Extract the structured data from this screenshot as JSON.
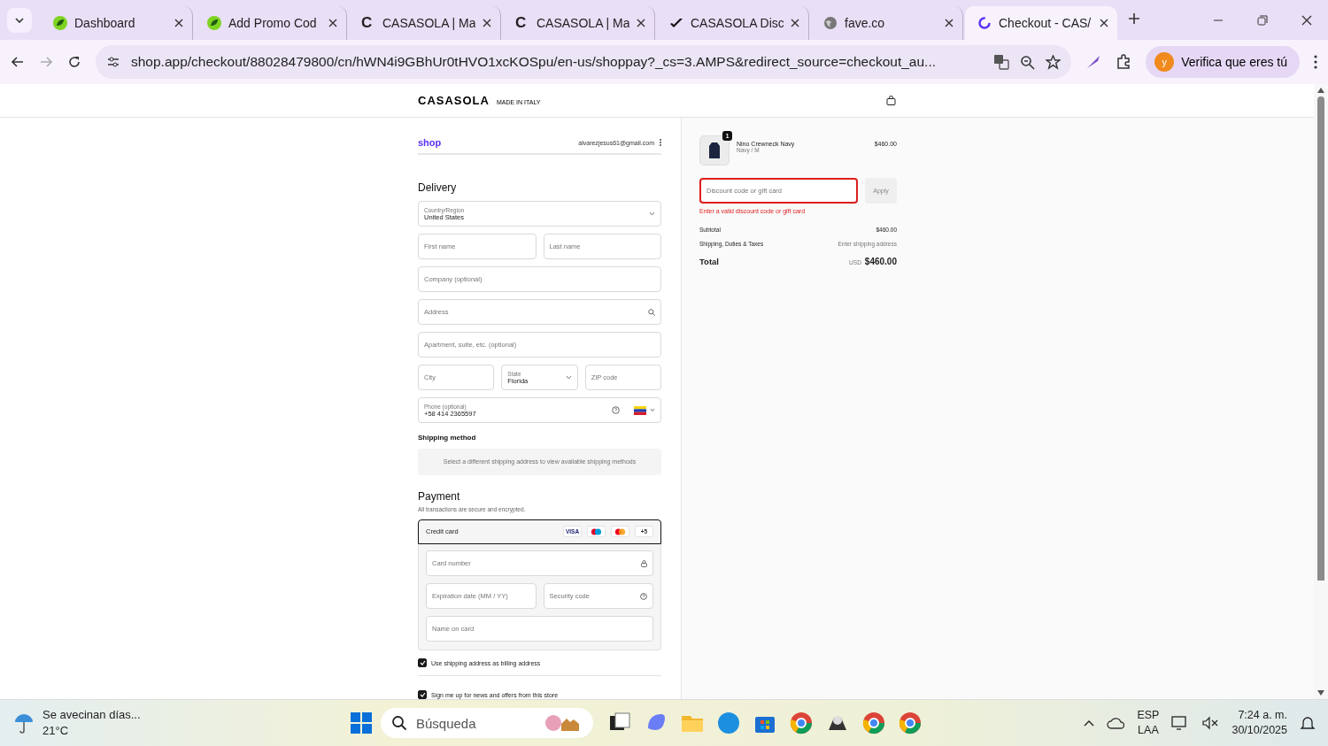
{
  "browser": {
    "tabs": [
      {
        "title": "Dashboard",
        "kind": "leaf",
        "selected": false
      },
      {
        "title": "Add Promo Cod",
        "kind": "leaf",
        "selected": false
      },
      {
        "title": "CASASOLA | Ma",
        "kind": "letter",
        "glyph": "C",
        "selected": false
      },
      {
        "title": "CASASOLA | Ma",
        "kind": "letter",
        "glyph": "C",
        "selected": false
      },
      {
        "title": "CASASOLA Disc",
        "kind": "swoosh",
        "selected": false
      },
      {
        "title": "fave.co",
        "kind": "globe",
        "selected": false
      },
      {
        "title": "Checkout - CAS/",
        "kind": "ring",
        "selected": true
      }
    ],
    "url": "shop.app/checkout/88028479800/cn/hWN4i9GBhUr0tHVO1xcKOSpu/en-us/shoppay?_cs=3.AMPS&redirect_source=checkout_au...",
    "profile": {
      "avatar": "y",
      "label": "Verifica que eres tú"
    }
  },
  "header": {
    "brand": "CASASOLA",
    "tagline": "MADE IN ITALY"
  },
  "account": {
    "shop": "shop",
    "email": "alvarezjesus61@gmail.com"
  },
  "delivery": {
    "heading": "Delivery",
    "rows": [
      [
        {
          "kind": "select",
          "label": "Country/Region",
          "value": "United States"
        }
      ],
      [
        {
          "kind": "text",
          "placeholder": "First name"
        },
        {
          "kind": "text",
          "placeholder": "Last name"
        }
      ],
      [
        {
          "kind": "text",
          "placeholder": "Company (optional)"
        }
      ],
      [
        {
          "kind": "search",
          "placeholder": "Address"
        }
      ],
      [
        {
          "kind": "text",
          "placeholder": "Apartment, suite, etc. (optional)"
        }
      ],
      [
        {
          "kind": "text",
          "placeholder": "City"
        },
        {
          "kind": "select",
          "label": "State",
          "value": "Florida"
        },
        {
          "kind": "text",
          "placeholder": "ZIP code"
        }
      ],
      [
        {
          "kind": "phone",
          "label": "Phone (optional)",
          "value": "+58 414 2365597"
        }
      ]
    ]
  },
  "shipping": {
    "heading": "Shipping method",
    "notice": "Select a different shipping address to view available shipping methods"
  },
  "payment": {
    "heading": "Payment",
    "note": "All transactions are secure and encrypted.",
    "method": {
      "label": "Credit card",
      "selected": true,
      "brands": [
        {
          "kind": "visa",
          "text": "VISA"
        },
        {
          "kind": "maestro"
        },
        {
          "kind": "mastercard"
        },
        {
          "kind": "more",
          "text": "+5"
        }
      ]
    },
    "rows": [
      [
        {
          "kind": "lock",
          "placeholder": "Card number"
        }
      ],
      [
        {
          "kind": "text",
          "placeholder": "Expiration date (MM / YY)"
        },
        {
          "kind": "help",
          "placeholder": "Security code"
        }
      ],
      [
        {
          "kind": "text",
          "placeholder": "Name on card"
        }
      ]
    ]
  },
  "checkboxes": [
    {
      "label": "Use shipping address as billing address",
      "checked": true
    },
    {
      "label": "Sign me up for news and offers from this store",
      "checked": true
    }
  ],
  "summary": {
    "item": {
      "name": "Nino Crewneck Navy",
      "variant": "Navy / M",
      "price": "$460.00",
      "quantity": "1"
    },
    "discount": {
      "placeholder": "Discount code or gift card",
      "error": true,
      "error_text": "Enter a valid discount code or gift card",
      "button": "Apply"
    },
    "lines": [
      {
        "label": "Subtotal",
        "value": "$460.00"
      },
      {
        "label": "Shipping, Duties & Taxes",
        "value": "Enter shipping address"
      }
    ],
    "total": {
      "label": "Total",
      "currency": "USD",
      "value": "$460.00"
    }
  },
  "taskbar": {
    "weather": {
      "title": "Se avecinan días...",
      "temp": "21°C"
    },
    "search": "Búsqueda",
    "lang": [
      "ESP",
      "LAA"
    ],
    "time": "7:24 a. m.",
    "date": "30/10/2025"
  }
}
